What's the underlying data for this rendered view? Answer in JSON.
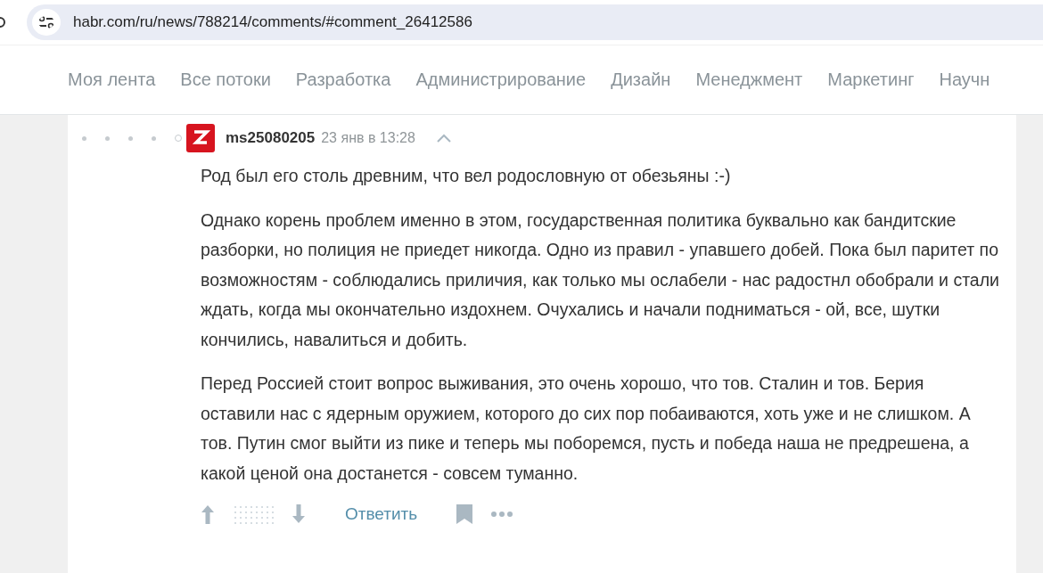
{
  "address_bar": {
    "url": "habr.com/ru/news/788214/comments/#comment_26412586"
  },
  "nav": {
    "items": [
      {
        "label": "Моя лента"
      },
      {
        "label": "Все потоки"
      },
      {
        "label": "Разработка"
      },
      {
        "label": "Администрирование"
      },
      {
        "label": "Дизайн"
      },
      {
        "label": "Менеджмент"
      },
      {
        "label": "Маркетинг"
      },
      {
        "label": "Научн"
      }
    ]
  },
  "comment": {
    "thread_markers": [
      {
        "kind": "dot"
      },
      {
        "kind": "dot"
      },
      {
        "kind": "dot"
      },
      {
        "kind": "dot"
      },
      {
        "kind": "ring"
      }
    ],
    "author": "ms25080205",
    "time": "23 янв в 13:28",
    "paragraphs": [
      "Род был его столь древним, что вел родословную от обезьяны :-)",
      "Однако корень проблем именно в этом, государственная политика буквально как бандитские разборки, но полиция не приедет никогда. Одно из правил - упавшего добей. Пока был паритет по возможностям - соблюдались приличия, как только мы ослабели - нас радостнл обобрали и стали ждать, когда мы окончательно издохнем. Очухались и начали подниматься - ой, все, шутки кончились, навалиться и добить.",
      "Перед Россией стоит вопрос выживания, это очень хорошо, что тов. Сталин и тов. Берия оставили нас с ядерным оружием, которого до сих пор побаиваются, хоть уже и не слишком. А тов. Путин смог выйти из пике и теперь мы поборемся, пусть и победа наша не предрешена, а какой ценой она достанется - совсем туманно."
    ],
    "reply_label": "Ответить"
  }
}
